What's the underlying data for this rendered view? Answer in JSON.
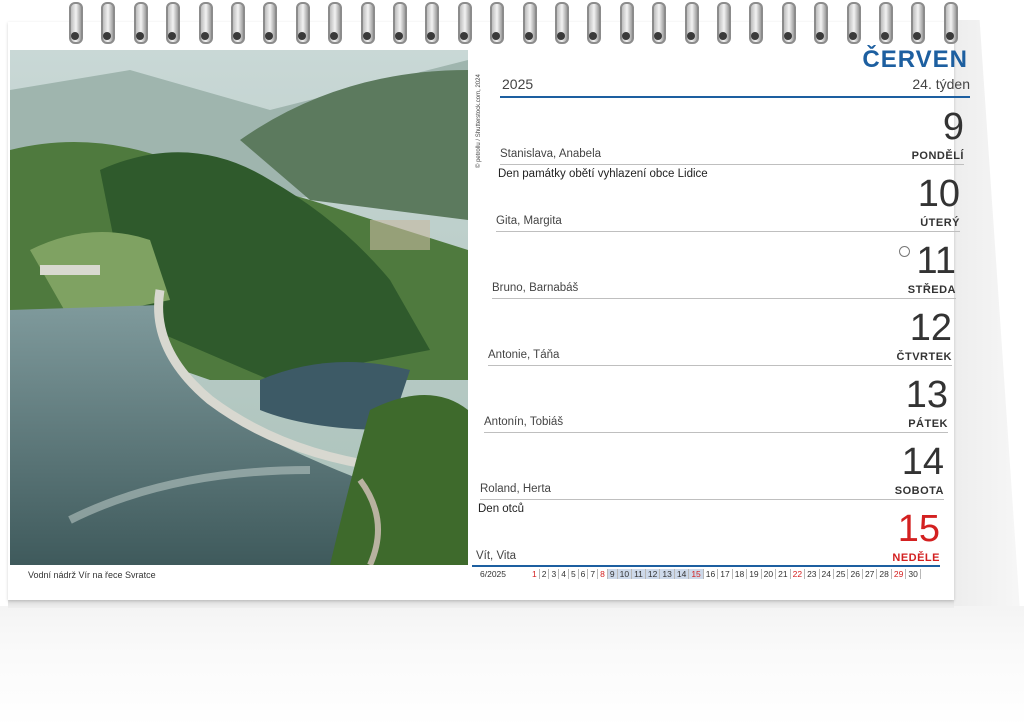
{
  "header": {
    "month": "ČERVEN",
    "year": "2025",
    "week": "24. týden"
  },
  "photo": {
    "credit": "© petrollu / Shutterstock.com, 2024",
    "caption": "Vodní nádrž Vír na řece Svratce"
  },
  "days": [
    {
      "number": "9",
      "weekday": "PONDĚLÍ",
      "names": "Stanislava, Anabela",
      "holiday": "Den památky obětí vyhlazení obce Lidice"
    },
    {
      "number": "10",
      "weekday": "ÚTERÝ",
      "names": "Gita, Margita",
      "holiday": ""
    },
    {
      "number": "11",
      "weekday": "STŘEDA",
      "names": "Bruno, Barnabáš",
      "holiday": "",
      "moon": "first-quarter-moon-icon"
    },
    {
      "number": "12",
      "weekday": "ČTVRTEK",
      "names": "Antonie, Táňa",
      "holiday": ""
    },
    {
      "number": "13",
      "weekday": "PÁTEK",
      "names": "Antonín, Tobiáš",
      "holiday": ""
    },
    {
      "number": "14",
      "weekday": "SOBOTA",
      "names": "Roland, Herta",
      "holiday": "Den otců"
    },
    {
      "number": "15",
      "weekday": "NEDĚLE",
      "names": "Vít, Vita",
      "holiday": ""
    }
  ],
  "mini_calendar": {
    "label": "6/2025",
    "days": [
      "1",
      "2",
      "3",
      "4",
      "5",
      "6",
      "7",
      "8",
      "9",
      "10",
      "11",
      "12",
      "13",
      "14",
      "15",
      "16",
      "17",
      "18",
      "19",
      "20",
      "21",
      "22",
      "23",
      "24",
      "25",
      "26",
      "27",
      "28",
      "29",
      "30"
    ],
    "red_days": [
      "1",
      "8",
      "15",
      "22",
      "29"
    ],
    "current_week": [
      "9",
      "10",
      "11",
      "12",
      "13",
      "14",
      "15"
    ]
  },
  "colors": {
    "accent": "#1d5fa0",
    "sunday": "#d32020"
  }
}
